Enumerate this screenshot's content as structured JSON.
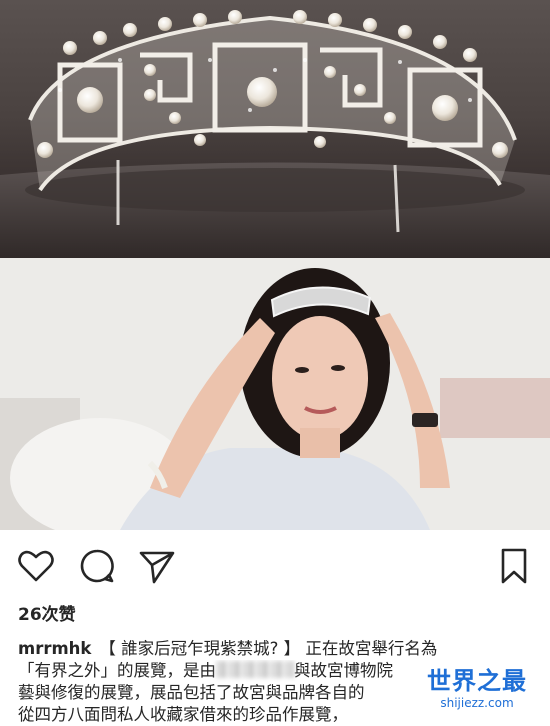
{
  "photos": {
    "tiara": {
      "description_icon": "tiara-photo"
    },
    "portrait": {
      "description_icon": "portrait-photo"
    }
  },
  "actions": {
    "like_icon": "heart-icon",
    "comment_icon": "comment-icon",
    "share_icon": "send-icon",
    "save_icon": "bookmark-icon"
  },
  "post": {
    "likes": "26次赞",
    "username": "mrrmhk",
    "caption_line1": "【 誰家后冠乍現紫禁城? 】 正在故宮舉行名為",
    "caption_line2a": "「有界之外」的展覽，是由",
    "caption_line2b": "與故宮博物院",
    "caption_line3": "藝與修復的展覽，展品包括了故宮與品牌各自的",
    "caption_line4": "從四方八面問私人收藏家借來的珍品作展覽，"
  },
  "watermark": {
    "title": "世界之最",
    "url": "shijiezz.com"
  },
  "colors": {
    "text": "#262626",
    "watermark": "#1f6fd6"
  }
}
